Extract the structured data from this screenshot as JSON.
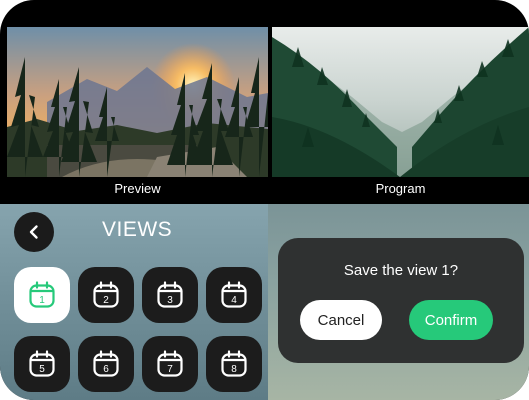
{
  "monitors": {
    "preview_label": "Preview",
    "program_label": "Program"
  },
  "views_panel": {
    "back_icon": "chevron-left-icon",
    "title": "VIEWS",
    "tile_icon": "calendar-icon",
    "active_index": 1,
    "tiles": [
      "1",
      "2",
      "3",
      "4",
      "5",
      "6",
      "7",
      "8"
    ]
  },
  "dialog": {
    "message": "Save the view 1?",
    "cancel_label": "Cancel",
    "confirm_label": "Confirm"
  },
  "colors": {
    "accent_green": "#26c97a",
    "tile_dark": "#1c1c1c",
    "dialog_bg": "#2f3131"
  }
}
